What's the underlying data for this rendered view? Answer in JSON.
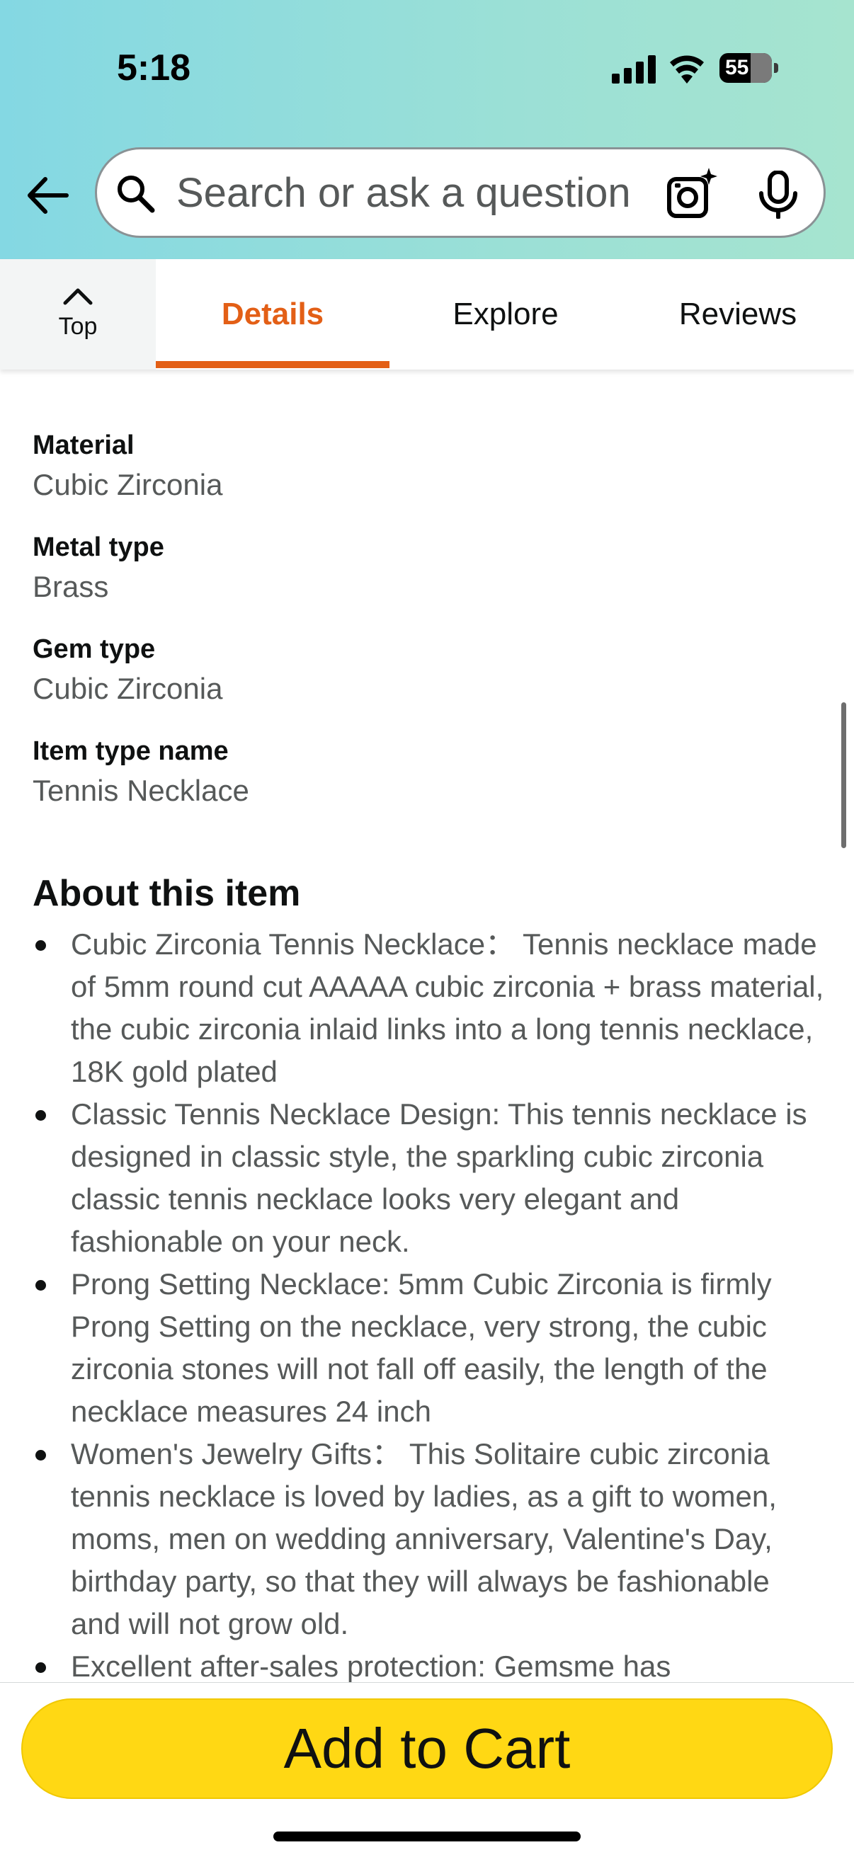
{
  "status_bar": {
    "time": "5:18",
    "battery": "55"
  },
  "search": {
    "placeholder": "Search or ask a question"
  },
  "tabs": {
    "top_label": "Top",
    "items": [
      {
        "label": "Details",
        "active": true
      },
      {
        "label": "Explore",
        "active": false
      },
      {
        "label": "Reviews",
        "active": false
      }
    ]
  },
  "specs": [
    {
      "key": "Material",
      "value": "Cubic Zirconia"
    },
    {
      "key": "Metal type",
      "value": "Brass"
    },
    {
      "key": "Gem type",
      "value": "Cubic Zirconia"
    },
    {
      "key": "Item type name",
      "value": "Tennis Necklace"
    }
  ],
  "about": {
    "title": "About this item",
    "bullets": [
      "Cubic Zirconia Tennis Necklace： Tennis necklace made of 5mm round cut AAAAA cubic zirconia + brass material, the cubic zirconia inlaid links into a long tennis necklace, 18K gold plated",
      "Classic Tennis Necklace Design: This tennis necklace is designed in classic style, the sparkling cubic zirconia classic tennis necklace looks very elegant and fashionable on your neck.",
      "Prong Setting Necklace: 5mm Cubic Zirconia is firmly Prong Setting on the necklace, very strong, the cubic zirconia stones will not fall off easily, the length of the necklace measures 24 inch",
      "Women's Jewelry Gifts： This Solitaire cubic zirconia tennis necklace is loved by ladies, as a gift to women, moms, men on wedding anniversary, Valentine's Day, birthday party, so that they will always be fashionable and will not grow old.",
      "Excellent after-sales protection: Gemsme has"
    ]
  },
  "cart": {
    "label": "Add to Cart"
  },
  "colors": {
    "accent": "#e35f16",
    "cart_button": "#ffd814"
  }
}
